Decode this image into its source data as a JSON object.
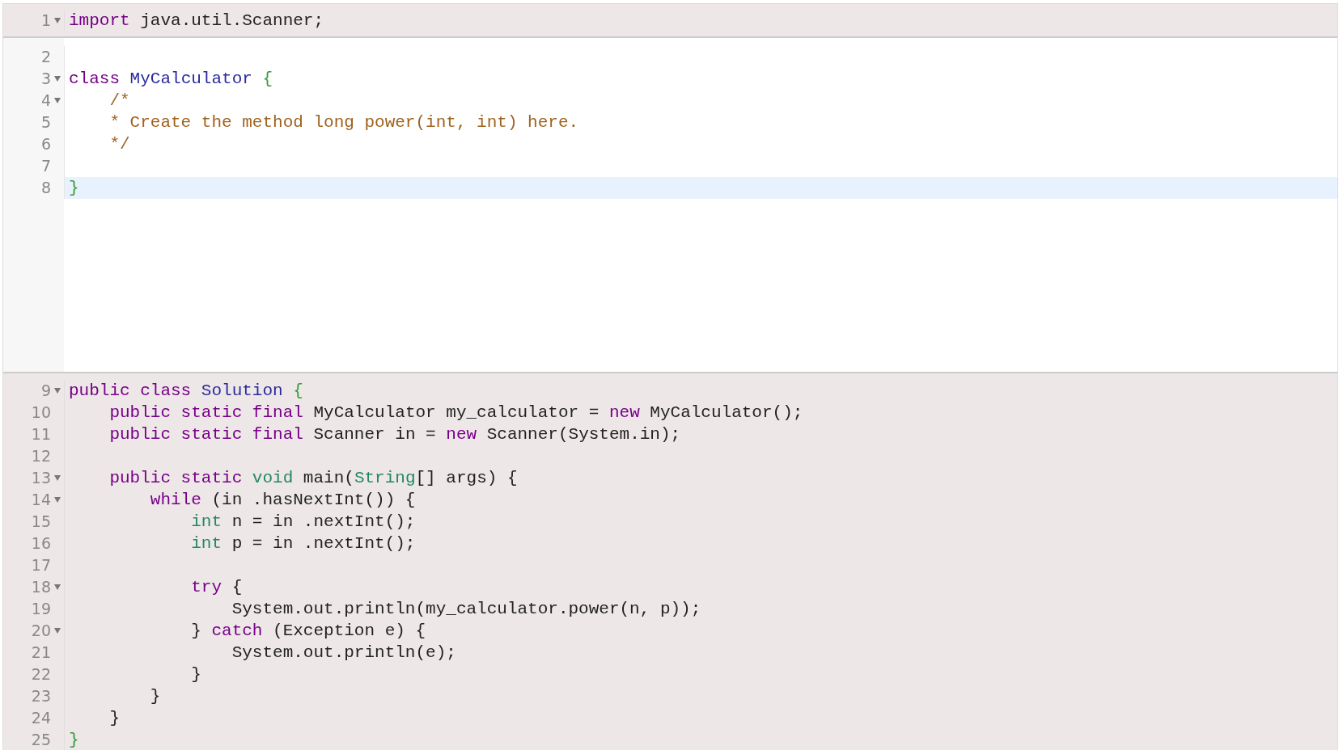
{
  "sections": [
    {
      "kind": "readonly",
      "lines": [
        {
          "number": "1",
          "foldable": true,
          "active": false,
          "tokens": [
            {
              "color": "#770088",
              "text": "import"
            },
            {
              "color": "#222222",
              "text": " java.util.Scanner;"
            }
          ]
        }
      ]
    },
    {
      "kind": "editable",
      "lines": [
        {
          "number": "2",
          "foldable": false,
          "active": false
        },
        {
          "number": "3",
          "foldable": true,
          "active": false,
          "tokens": [
            {
              "color": "#770088",
              "text": "class"
            },
            {
              "color": "#2a2a9f",
              "text": " MyCalculator"
            },
            {
              "color": "#3a9a3a",
              "text": " {"
            }
          ]
        },
        {
          "number": "4",
          "foldable": true,
          "active": false,
          "tokens": [
            {
              "color": "#a0621e",
              "text": "    /*"
            }
          ]
        },
        {
          "number": "5",
          "foldable": false,
          "active": false,
          "tokens": [
            {
              "color": "#a0621e",
              "text": "    * Create the method long power(int, int) here."
            }
          ]
        },
        {
          "number": "6",
          "foldable": false,
          "active": false,
          "tokens": [
            {
              "color": "#a0621e",
              "text": "    */"
            }
          ]
        },
        {
          "number": "7",
          "foldable": false,
          "active": false
        },
        {
          "number": "8",
          "foldable": false,
          "active": true,
          "tokens": [
            {
              "color": "#3a9a3a",
              "text": "}"
            }
          ]
        }
      ]
    },
    {
      "kind": "readonly",
      "lines": [
        {
          "number": "9",
          "foldable": true,
          "active": false,
          "tokens": [
            {
              "color": "#770088",
              "text": "public class"
            },
            {
              "color": "#2a2a9f",
              "text": " Solution"
            },
            {
              "color": "#3a9a3a",
              "text": " {"
            }
          ]
        },
        {
          "number": "10",
          "foldable": false,
          "active": false,
          "tokens": [
            {
              "color": "#770088",
              "text": "    public static final"
            },
            {
              "color": "#222222",
              "text": " MyCalculator my_calculator = "
            },
            {
              "color": "#770088",
              "text": "new"
            },
            {
              "color": "#222222",
              "text": " MyCalculator();"
            }
          ]
        },
        {
          "number": "11",
          "foldable": false,
          "active": false,
          "tokens": [
            {
              "color": "#770088",
              "text": "    public static final"
            },
            {
              "color": "#222222",
              "text": " Scanner in = "
            },
            {
              "color": "#770088",
              "text": "new"
            },
            {
              "color": "#222222",
              "text": " Scanner(System.in);"
            }
          ]
        },
        {
          "number": "12",
          "foldable": false,
          "active": false
        },
        {
          "number": "13",
          "foldable": true,
          "active": false,
          "tokens": [
            {
              "color": "#770088",
              "text": "    public static"
            },
            {
              "color": "#228866",
              "text": " void"
            },
            {
              "color": "#222222",
              "text": " main("
            },
            {
              "color": "#228866",
              "text": "String"
            },
            {
              "color": "#222222",
              "text": "[] args) {"
            }
          ]
        },
        {
          "number": "14",
          "foldable": true,
          "active": false,
          "tokens": [
            {
              "color": "#770088",
              "text": "        while"
            },
            {
              "color": "#222222",
              "text": " (in .hasNextInt()) {"
            }
          ]
        },
        {
          "number": "15",
          "foldable": false,
          "active": false,
          "tokens": [
            {
              "color": "#228866",
              "text": "            int"
            },
            {
              "color": "#222222",
              "text": " n = in .nextInt();"
            }
          ]
        },
        {
          "number": "16",
          "foldable": false,
          "active": false,
          "tokens": [
            {
              "color": "#228866",
              "text": "            int"
            },
            {
              "color": "#222222",
              "text": " p = in .nextInt();"
            }
          ]
        },
        {
          "number": "17",
          "foldable": false,
          "active": false
        },
        {
          "number": "18",
          "foldable": true,
          "active": false,
          "tokens": [
            {
              "color": "#770088",
              "text": "            try"
            },
            {
              "color": "#222222",
              "text": " {"
            }
          ]
        },
        {
          "number": "19",
          "foldable": false,
          "active": false,
          "tokens": [
            {
              "color": "#222222",
              "text": "                System.out.println(my_calculator.power(n, p));"
            }
          ]
        },
        {
          "number": "20",
          "foldable": true,
          "active": false,
          "tokens": [
            {
              "color": "#222222",
              "text": "            }"
            },
            {
              "color": "#770088",
              "text": " catch"
            },
            {
              "color": "#222222",
              "text": " (Exception e) {"
            }
          ]
        },
        {
          "number": "21",
          "foldable": false,
          "active": false,
          "tokens": [
            {
              "color": "#222222",
              "text": "                System.out.println(e);"
            }
          ]
        },
        {
          "number": "22",
          "foldable": false,
          "active": false,
          "tokens": [
            {
              "color": "#222222",
              "text": "            }"
            }
          ]
        },
        {
          "number": "23",
          "foldable": false,
          "active": false,
          "tokens": [
            {
              "color": "#222222",
              "text": "        }"
            }
          ]
        },
        {
          "number": "24",
          "foldable": false,
          "active": false,
          "tokens": [
            {
              "color": "#222222",
              "text": "    }"
            }
          ]
        },
        {
          "number": "25",
          "foldable": false,
          "active": false,
          "tokens": [
            {
              "color": "#3a9a3a",
              "text": "}"
            }
          ]
        }
      ]
    }
  ]
}
